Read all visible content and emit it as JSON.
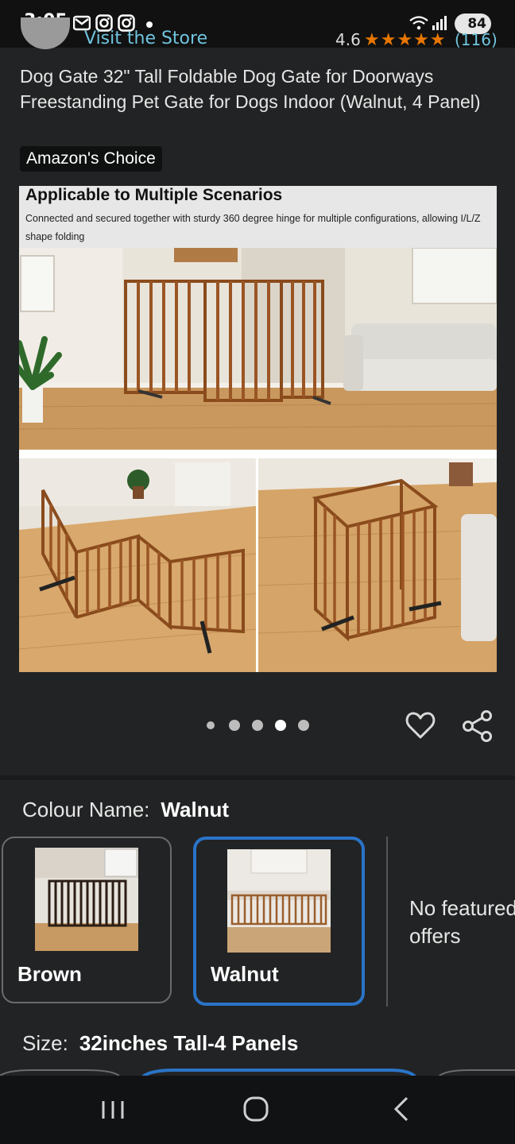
{
  "status_bar": {
    "time": "3:05",
    "icons": [
      "mail-icon",
      "instagram-icon",
      "instagram-icon",
      "wifi-icon",
      "signal-icon"
    ],
    "battery": "84"
  },
  "store": {
    "link_text": "Visit the Store",
    "rating": "4.6",
    "rating_stars": 4.5,
    "rating_count": "(116)"
  },
  "product": {
    "title": "Dog Gate 32\" Tall Foldable Dog Gate for Doorways Freestanding Pet Gate for Dogs Indoor (Walnut, 4 Panel)",
    "badge": "Amazon's Choice"
  },
  "image": {
    "heading": "Applicable to Multiple Scenarios",
    "subtext": "Connected and secured together with sturdy 360 degree hinge for multiple configurations, allowing I/L/Z shape folding"
  },
  "carousel": {
    "total": 5,
    "active_index": 3
  },
  "colour": {
    "label": "Colour Name:",
    "selected": "Walnut",
    "options": [
      {
        "label": "Brown"
      },
      {
        "label": "Walnut"
      }
    ],
    "no_offers": "No featured offers"
  },
  "size": {
    "label": "Size:",
    "selected": "32inches Tall-4 Panels"
  },
  "colors": {
    "background": "#222324",
    "link": "#6fc4de",
    "star": "#e77600",
    "selected_border": "#2a74c8"
  }
}
